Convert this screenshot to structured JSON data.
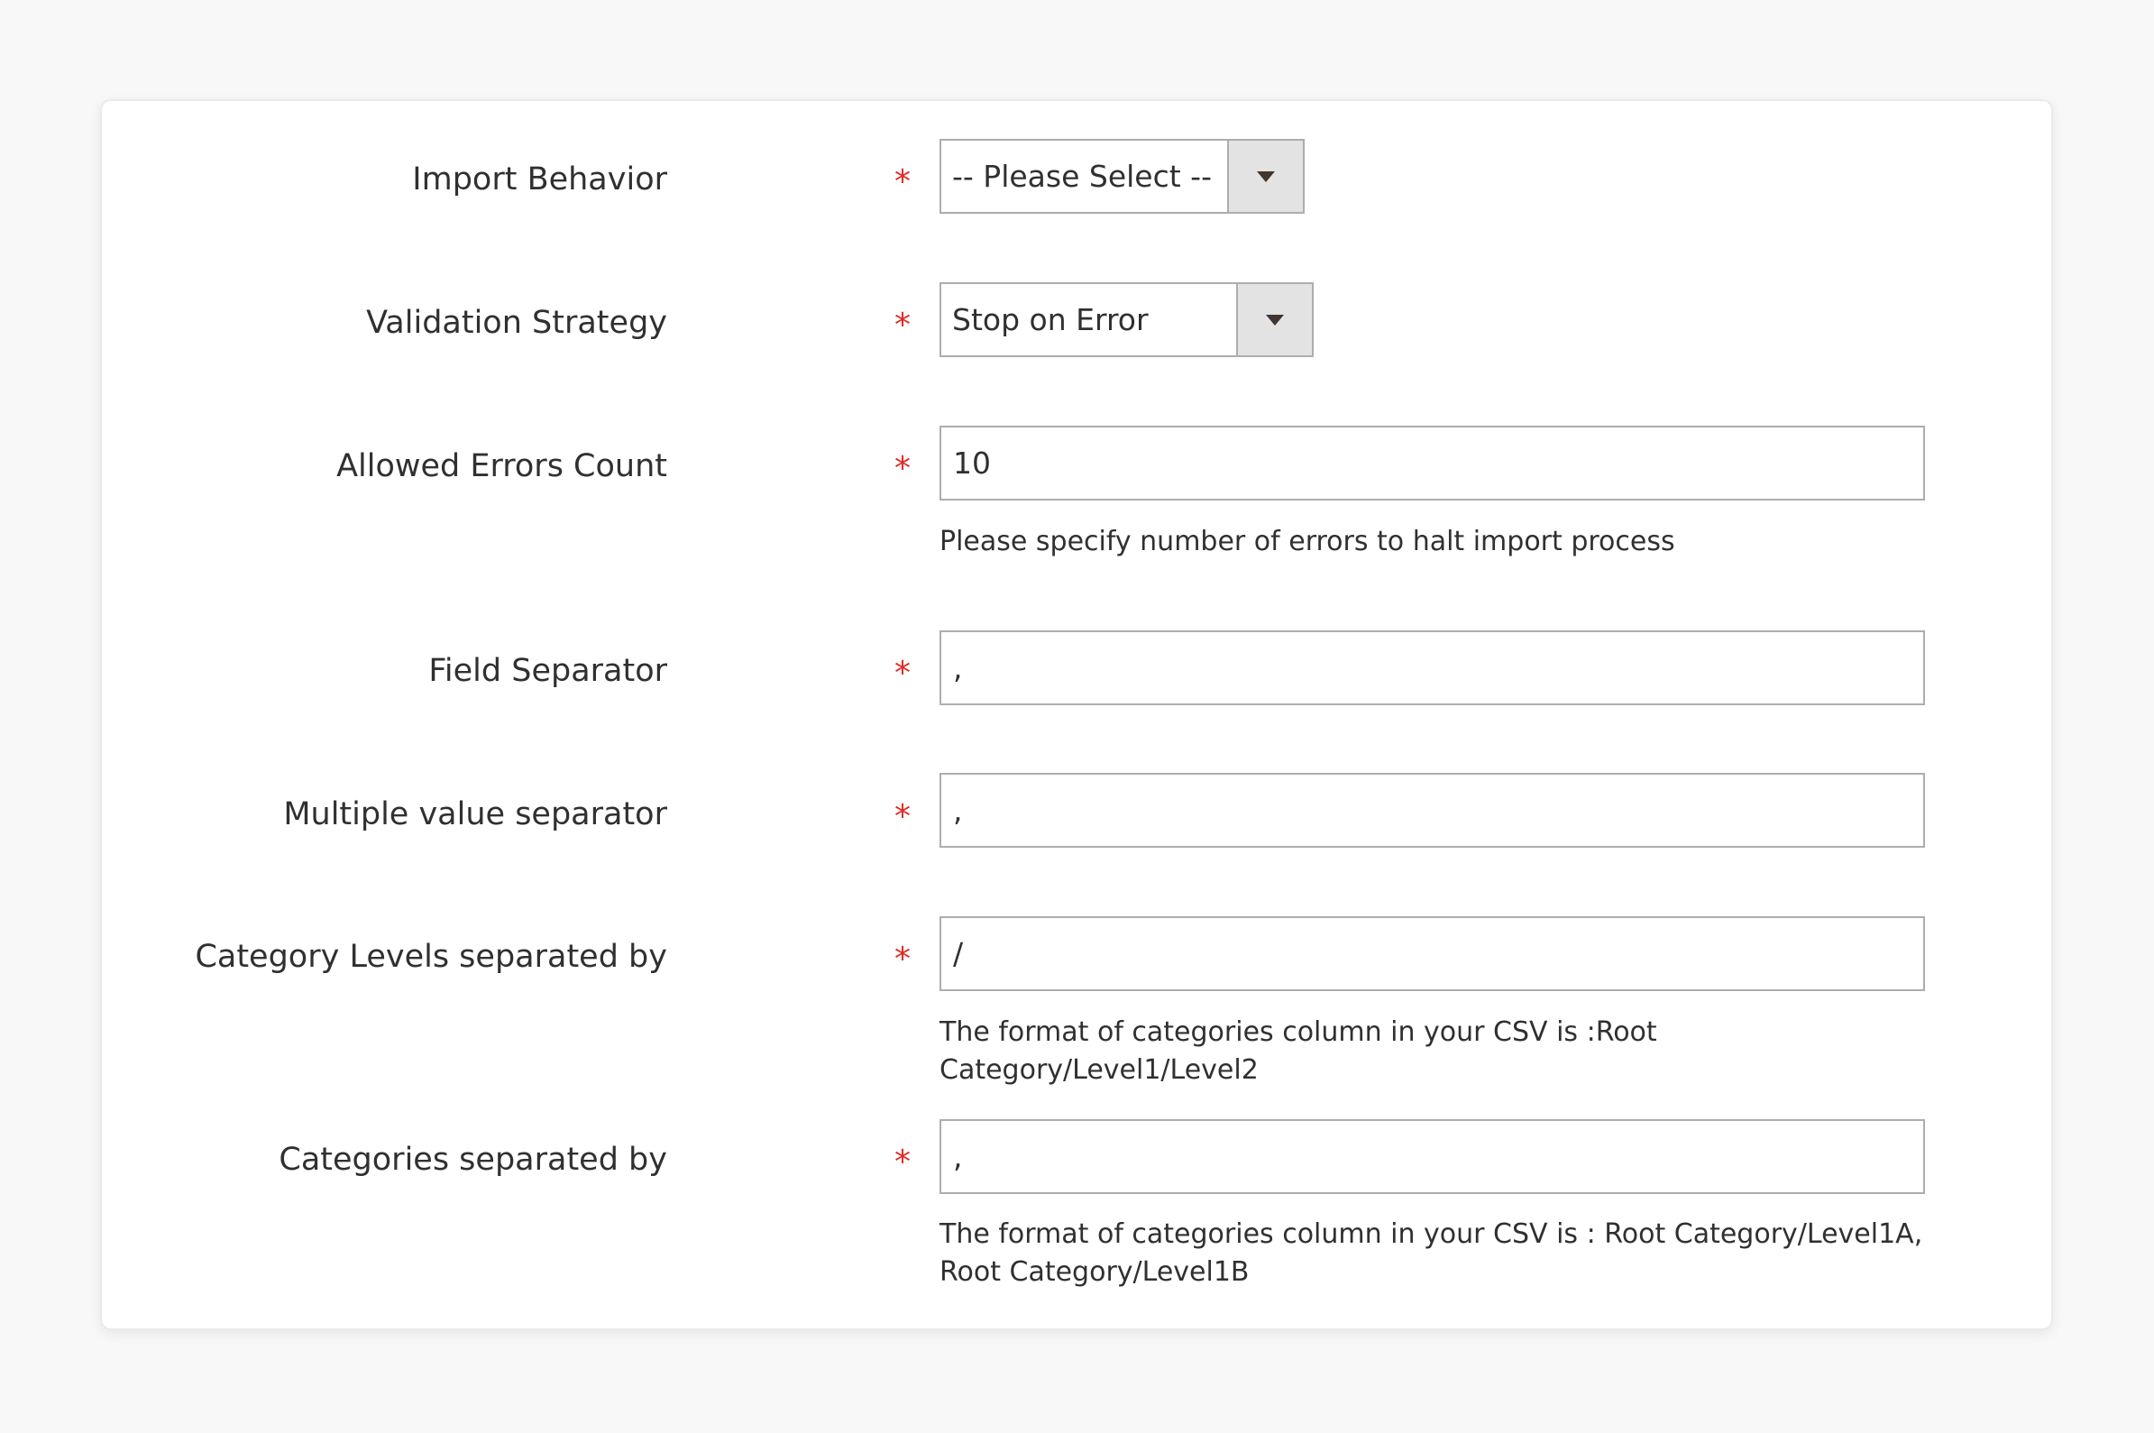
{
  "form": {
    "import_behavior": {
      "label": "Import Behavior",
      "required_mark": "*",
      "selected": "-- Please Select --",
      "arrow_icon": "chevron-down-icon"
    },
    "validation_strategy": {
      "label": "Validation Strategy",
      "required_mark": "*",
      "selected": "Stop on Error",
      "arrow_icon": "chevron-down-icon"
    },
    "allowed_errors_count": {
      "label": "Allowed Errors Count",
      "required_mark": "*",
      "value": "10",
      "note": "Please specify number of errors to halt import process"
    },
    "field_separator": {
      "label": "Field Separator",
      "required_mark": "*",
      "value": ","
    },
    "multiple_value_separator": {
      "label": "Multiple value separator",
      "required_mark": "*",
      "value": ","
    },
    "category_levels_separator": {
      "label": "Category Levels separated by",
      "required_mark": "*",
      "value": "/",
      "note": "The format of categories column in your CSV is :Root Category/Level1/Level2"
    },
    "categories_separator": {
      "label": "Categories separated by",
      "required_mark": "*",
      "value": ",",
      "note": "The format of categories column in your CSV is : Root Category/Level1A, Root Category/Level1B"
    }
  },
  "colors": {
    "required": "#e02b27",
    "text": "#303030",
    "border": "#adadad",
    "select_button": "#e3e3e3",
    "page_background": "#f8f8f8"
  }
}
